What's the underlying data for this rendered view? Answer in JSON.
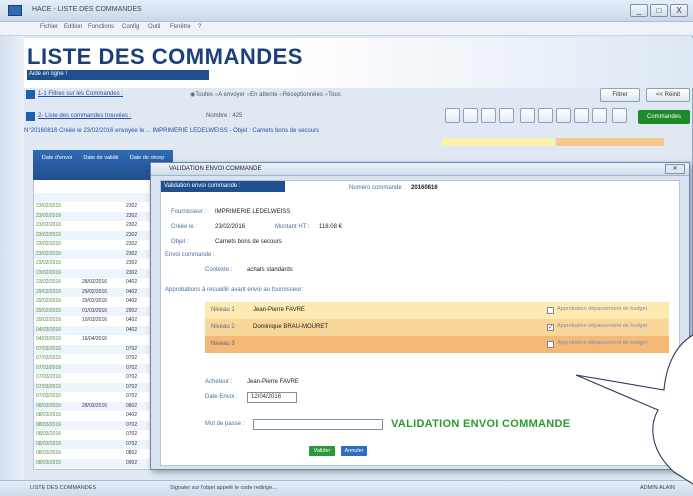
{
  "window": {
    "title": "HACE - LISTE DES COMMANDES",
    "controls": [
      "_",
      "□",
      "X"
    ]
  },
  "menu": [
    "Fichier",
    "Edition",
    "Fonctions",
    "Config",
    "Outil",
    "Fenêtre",
    "?"
  ],
  "header": {
    "title": "LISTE DES COMMANDES",
    "subtitle": "Aide en ligne !"
  },
  "filters": {
    "row1_link": "1-1 Filtres sur les Commandes :",
    "row1_options": "◉Toutes ○A envoyer ○En attente ○Réceptionnées ○Tous",
    "row2_link": "2- Liste des commandes trouvées :",
    "row2_count": "Nombre : 425",
    "filter_btn": "Filtrer",
    "reinit_btn": "<< Réinit",
    "commandes_btn": "Commandes"
  },
  "info_line": "N°20160816 Créée le 23/02/2016 envoyée le ... IMPRIMERIE LEDELWEISS - Objet : Carnets bons de secours",
  "table": {
    "headers": [
      "Date d'envoi",
      "Date de validé",
      "Date de récep"
    ],
    "rows": [
      [
        "",
        "",
        ""
      ],
      [
        "",
        "",
        ""
      ],
      [
        "23/02/2016",
        "",
        "2302"
      ],
      [
        "23/02/2016",
        "",
        "2302"
      ],
      [
        "23/02/2016",
        "",
        "2302"
      ],
      [
        "23/02/2016",
        "",
        "2302"
      ],
      [
        "23/02/2016",
        "",
        "2302"
      ],
      [
        "23/02/2016",
        "",
        "2302"
      ],
      [
        "23/02/2016",
        "",
        "2302"
      ],
      [
        "23/02/2016",
        "",
        "2302"
      ],
      [
        "23/02/2016",
        "28/02/2016",
        "0402"
      ],
      [
        "29/02/2016",
        "29/02/2016",
        "0402"
      ],
      [
        "29/02/2016",
        "29/02/2016",
        "0402"
      ],
      [
        "29/02/2016",
        "01/03/2016",
        "2902"
      ],
      [
        "29/02/2016",
        "10/03/2016",
        "0402"
      ],
      [
        "04/03/2016",
        "",
        "0402"
      ],
      [
        "04/03/2016",
        "16/04/2016",
        ""
      ],
      [
        "07/03/2016",
        "",
        "0702"
      ],
      [
        "07/03/2016",
        "",
        "0702"
      ],
      [
        "07/03/2016",
        "",
        "0702"
      ],
      [
        "07/03/2016",
        "",
        "0702"
      ],
      [
        "07/03/2016",
        "",
        "0702"
      ],
      [
        "07/03/2016",
        "",
        "0702"
      ],
      [
        "08/03/2016",
        "28/03/2016",
        "0802"
      ],
      [
        "08/03/2016",
        "",
        "0402"
      ],
      [
        "08/03/2016",
        "",
        "0702"
      ],
      [
        "08/03/2016",
        "",
        "0702"
      ],
      [
        "08/03/2016",
        "",
        "0702"
      ],
      [
        "08/03/2016",
        "",
        "0802"
      ],
      [
        "08/03/2016",
        "",
        "0902"
      ]
    ]
  },
  "dialog": {
    "title": "VALIDATION ENVOI COMMANDE",
    "section": "Validation envoi commande :",
    "numero_label": "Numéro commande :",
    "numero_value": "20160816",
    "fournisseur_label": "Fournisseur :",
    "fournisseur_value": "IMPRIMERIE LEDELWEISS",
    "cree_label": "Créée le :",
    "cree_value": "23/02/2016",
    "montant_label": "Montant HT :",
    "montant_value": "118.08 €",
    "objet_label": "Objet :",
    "objet_value": "Carnets bons de secours",
    "envoi_label": "Envoi commande :",
    "contexte_label": "Contexte :",
    "contexte_value": "achats standards",
    "approb_label": "Approbations à recueillir avant envoi au fournisseur :",
    "approvals": [
      {
        "niveau": "Niveau 1",
        "person": "Jean-Pierre FAVRE",
        "checked": false,
        "chk_label": "Approbation dépassement de budget",
        "bg": "#fdeab0"
      },
      {
        "niveau": "Niveau 2",
        "person": "Dominique BRAU-MOURET",
        "checked": true,
        "chk_label": "Approbation dépassement de budget",
        "bg": "#f9d79a"
      },
      {
        "niveau": "Niveau 3",
        "person": "",
        "checked": false,
        "chk_label": "Approbation dépassement de budget",
        "bg": "#f4b877"
      }
    ],
    "acheteur_label": "Acheteur :",
    "acheteur_value": "Jean-Pierre FAVRE",
    "date_envoi_label": "Date Envoi :",
    "date_envoi_value": "12/04/2016",
    "mdp_label": "Mot de passe :",
    "mdp_value": "",
    "validation_text": "VALIDATION ENVOI COMMANDE",
    "valider_btn": "Valider",
    "annuler_btn": "Annuler"
  },
  "status": {
    "left": "LISTE DES COMMANDES",
    "mid": "Signaler sur l'objet appelé le code redirige...",
    "right": "ADMIN ALAIN"
  }
}
